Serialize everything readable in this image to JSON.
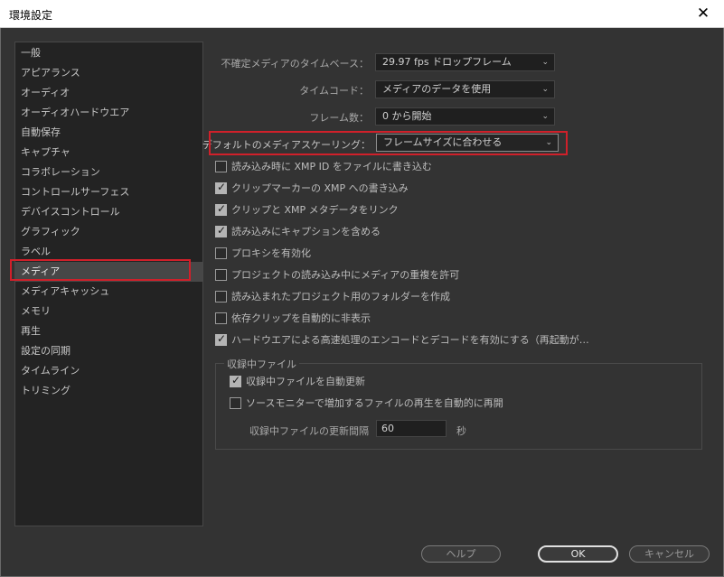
{
  "window": {
    "title": "環境設定",
    "close_glyph": "✕"
  },
  "sidebar": {
    "items": [
      {
        "label": "一般"
      },
      {
        "label": "アピアランス"
      },
      {
        "label": "オーディオ"
      },
      {
        "label": "オーディオハードウエア"
      },
      {
        "label": "自動保存"
      },
      {
        "label": "キャプチャ"
      },
      {
        "label": "コラボレーション"
      },
      {
        "label": "コントロールサーフェス"
      },
      {
        "label": "デバイスコントロール"
      },
      {
        "label": "グラフィック"
      },
      {
        "label": "ラベル"
      },
      {
        "label": "メディア"
      },
      {
        "label": "メディアキャッシュ"
      },
      {
        "label": "メモリ"
      },
      {
        "label": "再生"
      },
      {
        "label": "設定の同期"
      },
      {
        "label": "タイムライン"
      },
      {
        "label": "トリミング"
      }
    ],
    "selected": "メディア"
  },
  "settings": {
    "timebase": {
      "label": "不確定メディアのタイムベース：",
      "value": "29.97  fps ドロップフレーム"
    },
    "timecode": {
      "label": "タイムコード：",
      "value": "メディアのデータを使用"
    },
    "frame_number": {
      "label": "フレーム数：",
      "value": "0 から開始"
    },
    "scaling": {
      "label": "デフォルトのメディアスケーリング：",
      "value": "フレームサイズに合わせる"
    }
  },
  "checkboxes": [
    {
      "label": "読み込み時に XMP ID をファイルに書き込む",
      "checked": false
    },
    {
      "label": "クリップマーカーの XMP への書き込み",
      "checked": true
    },
    {
      "label": "クリップと XMP メタデータをリンク",
      "checked": true
    },
    {
      "label": "読み込みにキャプションを含める",
      "checked": true
    },
    {
      "label": "プロキシを有効化",
      "checked": false
    },
    {
      "label": "プロジェクトの読み込み中にメディアの重複を許可",
      "checked": false
    },
    {
      "label": "読み込まれたプロジェクト用のフォルダーを作成",
      "checked": false
    },
    {
      "label": "依存クリップを自動的に非表示",
      "checked": false
    },
    {
      "label": "ハードウエアによる高速処理のエンコードとデコードを有効にする（再起動が…",
      "checked": true
    }
  ],
  "growing_files": {
    "title": "収録中ファイル",
    "auto_refresh": {
      "label": "収録中ファイルを自動更新",
      "checked": true
    },
    "auto_resume": {
      "label": "ソースモニターで増加するファイルの再生を自動的に再開",
      "checked": false
    },
    "interval_label": "収録中ファイルの更新間隔",
    "interval_value": "60",
    "interval_unit": "秒"
  },
  "footer": {
    "help": "ヘルプ",
    "ok": "OK",
    "cancel": "キャンセル"
  },
  "colors": {
    "highlight_border": "#d0202a",
    "background": "#333333"
  }
}
